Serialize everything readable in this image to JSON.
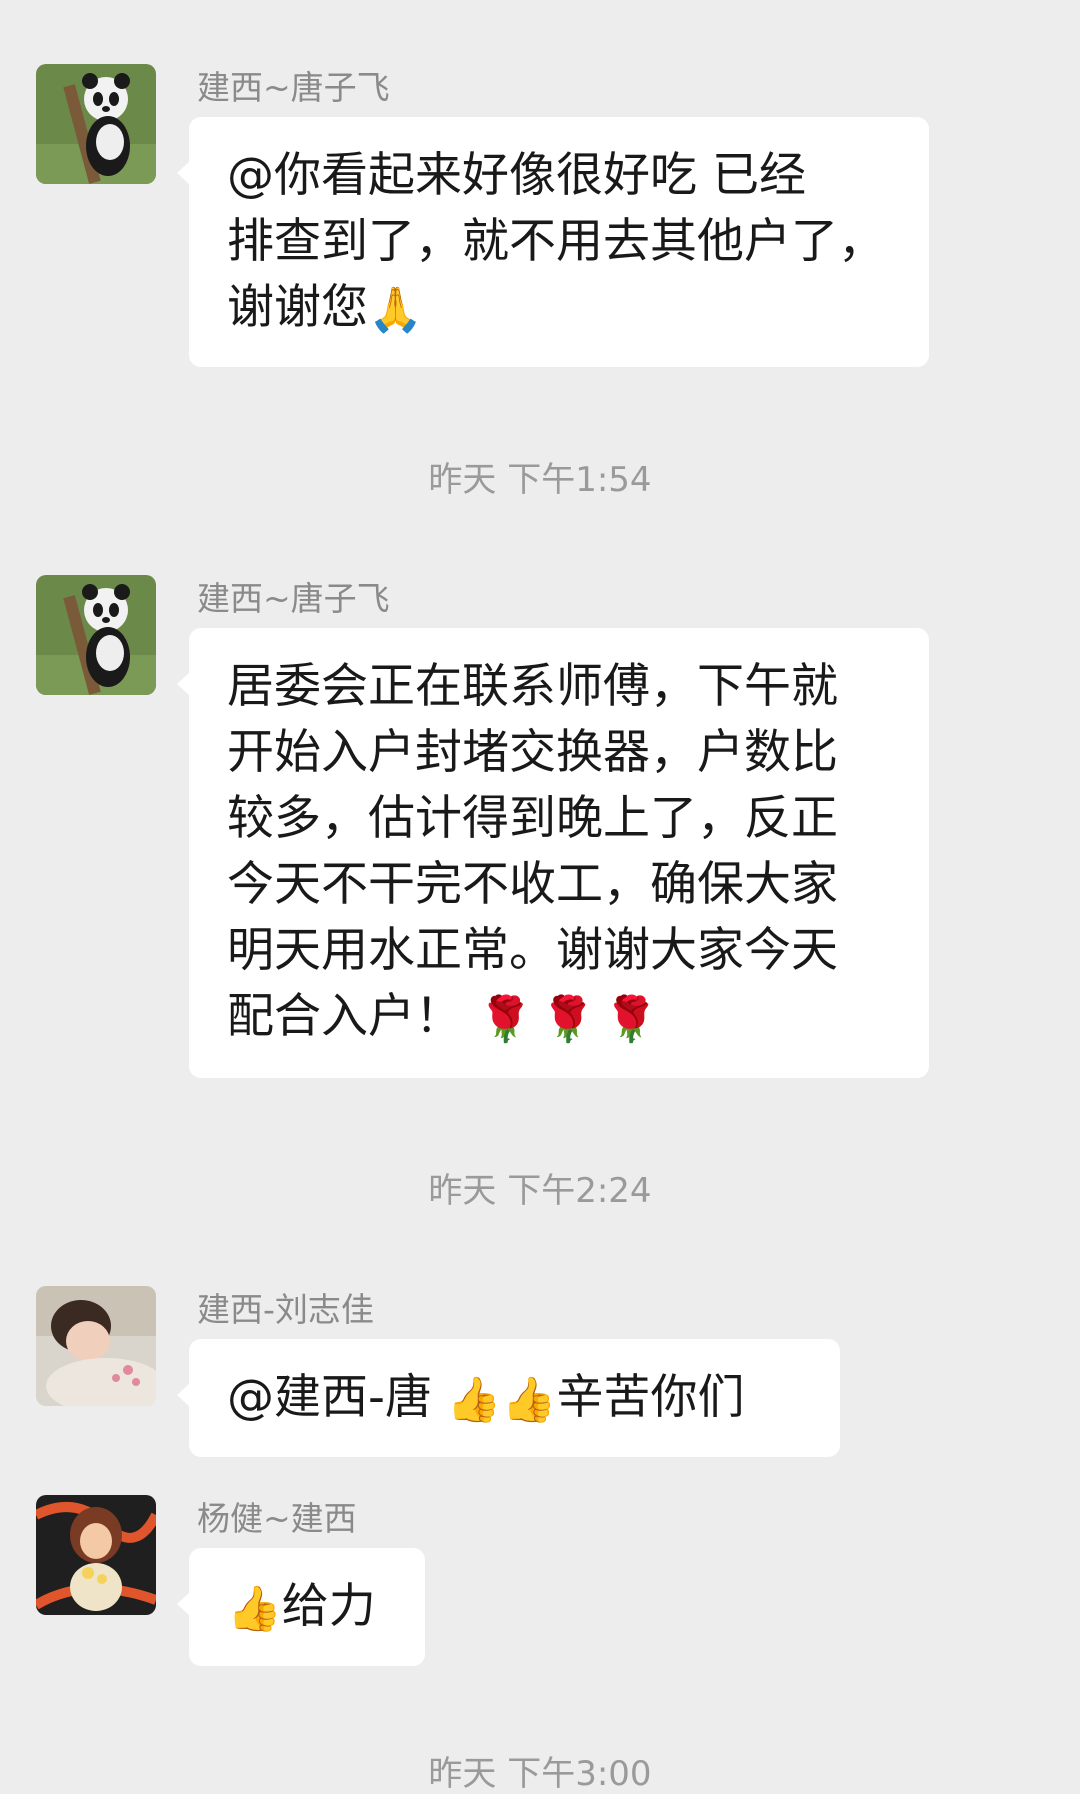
{
  "messages": [
    {
      "sender": "建西~唐子飞",
      "avatar": "panda-avatar",
      "lines": [
        "@你看起来好像很好吃  已经",
        "排查到了，就不用去其他户了，",
        "谢谢您"
      ],
      "emoji_end": "🙏"
    },
    {
      "sender": "建西~唐子飞",
      "avatar": "panda-avatar",
      "lines": [
        "居委会正在联系师傅，下午就",
        "开始入户封堵交换器，户数比",
        "较多，估计得到晚上了，反正",
        "今天不干完不收工，确保大家",
        "明天用水正常。谢谢大家今天",
        "配合入户！"
      ],
      "emoji_end": "🌹🌹🌹"
    },
    {
      "sender": "建西-刘志佳",
      "avatar": "girl-avatar",
      "text_before": "@建西-唐 ",
      "emoji": "👍👍",
      "text_after": "辛苦你们"
    },
    {
      "sender": "杨健~建西",
      "avatar": "illustration-avatar",
      "emoji": "👍",
      "text_after": "给力"
    }
  ],
  "timestamps": [
    "昨天 下午1:54",
    "昨天 下午2:24",
    "昨天 下午3:00"
  ],
  "colors": {
    "background": "#ededed",
    "bubble": "#ffffff",
    "sender": "#8a8a8a",
    "timestamp": "#9a9a9a"
  }
}
